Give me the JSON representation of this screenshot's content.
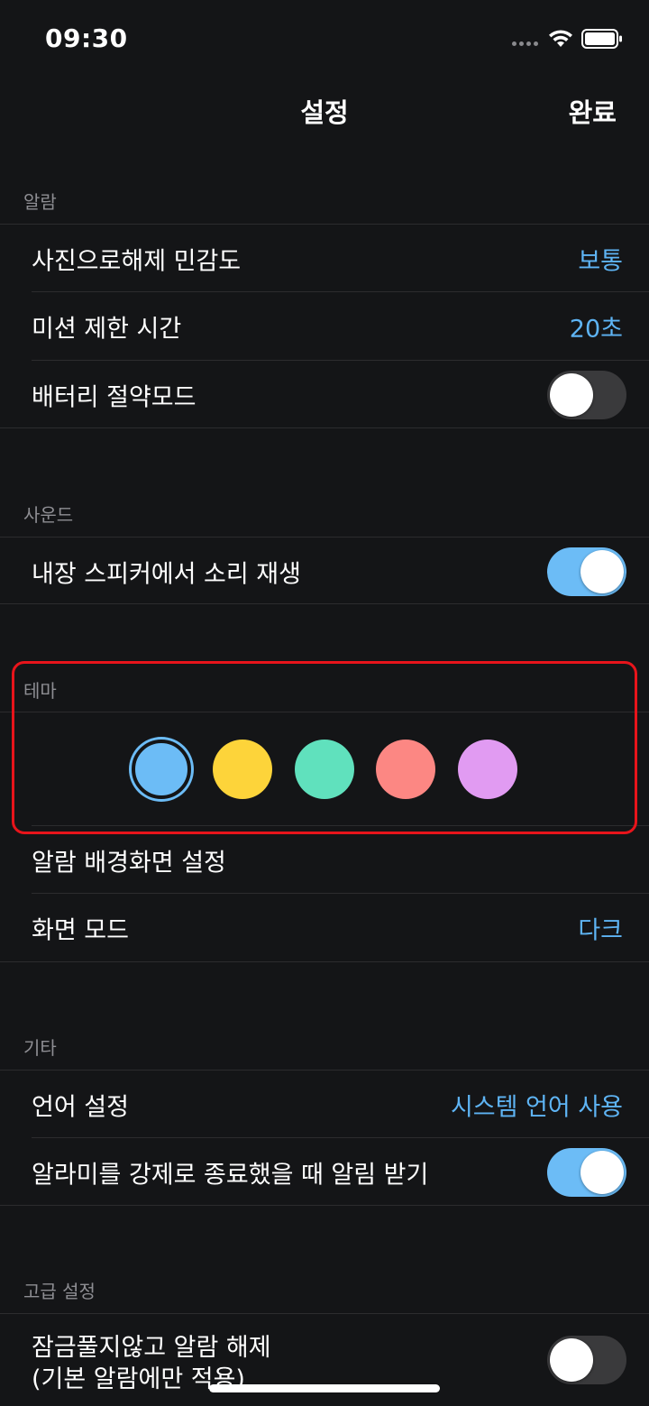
{
  "status_bar": {
    "time": "09:30"
  },
  "nav": {
    "title": "설정",
    "done_label": "완료"
  },
  "sections": {
    "alarm": {
      "header": "알람",
      "photo_sensitivity": {
        "label": "사진으로해제 민감도",
        "value": "보통"
      },
      "mission_time_limit": {
        "label": "미션 제한 시간",
        "value": "20초"
      },
      "battery_saver": {
        "label": "배터리 절약모드",
        "enabled": false
      }
    },
    "sound": {
      "header": "사운드",
      "builtin_speaker": {
        "label": "내장 스피커에서 소리 재생",
        "enabled": true
      }
    },
    "theme": {
      "header": "테마",
      "colors": [
        {
          "name": "blue",
          "hex": "#6cbcf6",
          "selected": true
        },
        {
          "name": "yellow",
          "hex": "#fdd43a",
          "selected": false
        },
        {
          "name": "mint",
          "hex": "#60e1bd",
          "selected": false
        },
        {
          "name": "coral",
          "hex": "#fc8783",
          "selected": false
        },
        {
          "name": "lavender",
          "hex": "#e19bf2",
          "selected": false
        }
      ],
      "wallpaper": {
        "label": "알람 배경화면 설정"
      },
      "display_mode": {
        "label": "화면 모드",
        "value": "다크"
      }
    },
    "etc": {
      "header": "기타",
      "language": {
        "label": "언어 설정",
        "value": "시스템 언어 사용"
      },
      "force_quit_notify": {
        "label": "알라미를 강제로 종료했을 때 알림 받기",
        "enabled": true
      }
    },
    "advanced": {
      "header": "고급 설정",
      "dismiss_without_unlock": {
        "label_line1": "잠금풀지않고 알람 해제",
        "label_line2": "(기본 알람에만 적용)",
        "enabled": false
      }
    }
  },
  "colors": {
    "background": "#141517",
    "accent": "#5eb4f4",
    "highlight": "#e8141b"
  }
}
